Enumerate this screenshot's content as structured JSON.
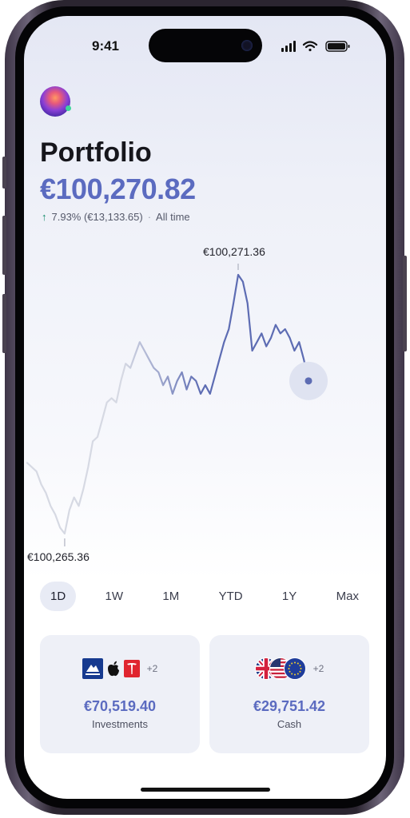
{
  "status_bar": {
    "time": "9:41"
  },
  "header": {
    "title": "Portfolio",
    "value": "€100,270.82",
    "change": "7.93% (€13,133.65)",
    "period": "All time"
  },
  "chart_data": {
    "type": "line",
    "high_label": "€100,271.36",
    "low_label": "€100,265.36",
    "values": [
      100267.0,
      100266.9,
      100266.8,
      100266.5,
      100266.3,
      100266.0,
      100265.8,
      100265.5,
      100265.36,
      100265.9,
      100266.2,
      100266.0,
      100266.4,
      100266.9,
      100267.5,
      100267.6,
      100268.0,
      100268.4,
      100268.5,
      100268.4,
      100268.9,
      100269.3,
      100269.2,
      100269.5,
      100269.8,
      100269.6,
      100269.4,
      100269.2,
      100269.1,
      100268.8,
      100269.0,
      100268.6,
      100268.9,
      100269.1,
      100268.7,
      100269.0,
      100268.9,
      100268.6,
      100268.8,
      100268.6,
      100269.0,
      100269.4,
      100269.8,
      100270.1,
      100270.7,
      100271.36,
      100271.2,
      100270.7,
      100269.6,
      100269.8,
      100270.0,
      100269.7,
      100269.9,
      100270.2,
      100270.0,
      100270.1,
      100269.9,
      100269.6,
      100269.8,
      100269.4,
      100268.9
    ],
    "ranges": [
      "1D",
      "1W",
      "1M",
      "YTD",
      "1Y",
      "Max"
    ],
    "active_range": "1D",
    "colors": {
      "line": "#5d6cb3",
      "faded": "#d6d9e3"
    }
  },
  "cards": {
    "investments": {
      "amount": "€70,519.40",
      "label": "Investments",
      "more": "+2",
      "icons": [
        "invesco-logo",
        "apple-logo",
        "tesla-logo"
      ]
    },
    "cash": {
      "amount": "€29,751.42",
      "label": "Cash",
      "more": "+2",
      "icons": [
        "gb-flag",
        "us-flag",
        "eu-flag"
      ]
    }
  },
  "colors": {
    "accent": "#5b6bc0",
    "positive": "#0f8a67"
  }
}
